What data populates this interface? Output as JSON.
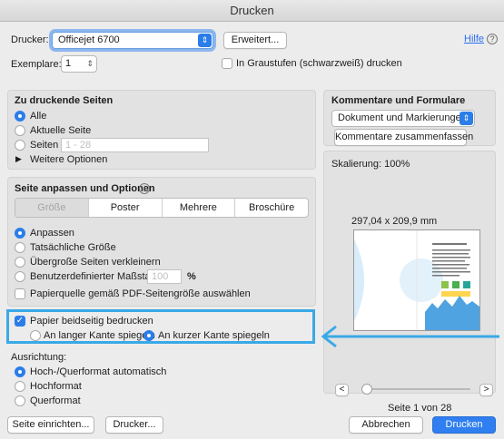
{
  "window": {
    "title": "Drucken"
  },
  "top": {
    "printer_label": "Drucker:",
    "printer_value": "Officejet 6700",
    "advanced_button": "Erweitert...",
    "help_link": "Hilfe",
    "help_icon": "?",
    "copies_label": "Exemplare:",
    "copies_value": "1",
    "grayscale_label": "In Graustufen (schwarzweiß) drucken"
  },
  "pages": {
    "heading": "Zu druckende Seiten",
    "all": "Alle",
    "current": "Aktuelle Seite",
    "pages": "Seiten",
    "pages_placeholder": "1 - 28",
    "more_options": "Weitere Optionen"
  },
  "fit": {
    "heading": "Seite anpassen und Optionen",
    "tabs": [
      "Größe",
      "Poster",
      "Mehrere",
      "Broschüre"
    ],
    "fit": "Anpassen",
    "actual": "Tatsächliche Größe",
    "shrink": "Übergroße Seiten verkleinern",
    "custom": "Benutzerdefinierter Maßstab:",
    "custom_value": "100",
    "custom_unit": "%",
    "paper_source": "Papierquelle gemäß PDF-Seitengröße auswählen"
  },
  "duplex": {
    "label": "Papier beidseitig bedrucken",
    "long_edge": "An langer Kante spiegeln",
    "short_edge": "An kurzer Kante spiegeln"
  },
  "orientation": {
    "heading": "Ausrichtung:",
    "auto": "Hoch-/Querformat automatisch",
    "portrait": "Hochformat",
    "landscape": "Querformat"
  },
  "comments": {
    "heading": "Kommentare und Formulare",
    "select_value": "Dokument und Markierungen",
    "summarize_button": "Kommentare zusammenfassen"
  },
  "preview": {
    "scaling": "Skalierung: 100%",
    "size": "297,04 x 209,9 mm",
    "page_status": "Seite 1 von 28",
    "prev": "<",
    "next": ">"
  },
  "bottom": {
    "page_setup": "Seite einrichten...",
    "printer": "Drucker...",
    "cancel": "Abbrechen",
    "print": "Drucken"
  },
  "colors": {
    "accent": "#2b7de9",
    "highlight": "#3aa9e6"
  }
}
